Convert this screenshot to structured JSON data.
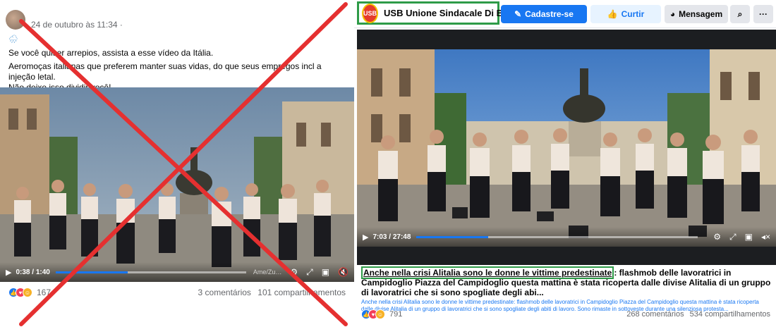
{
  "left_post": {
    "timestamp": "24 de outubro às 11:34 ·",
    "emoji": "🌧",
    "text_lines": [
      "Se você quiser arrepios, assista a esse vídeo da Itália.",
      " Aeromoças italianas que preferem manter suas vidas, do que seus empregos incl a injeção letal.",
      "Não deixe isso dividir você!"
    ],
    "video": {
      "time": "0:38 / 1:40",
      "progress": 0.38,
      "watermark": "Ame/Zu…"
    },
    "reaction_count": "167",
    "comments": "3 comentários",
    "shares": "101 compartilhamentos"
  },
  "right_post": {
    "page_name": "USB Unione Sindacale Di B...",
    "logo_text": "USB",
    "buttons": {
      "signup": "Cadastre-se",
      "like": "Curtir",
      "message": "Mensagem"
    },
    "video": {
      "time": "7:03 / 27:48",
      "progress": 0.254
    },
    "caption_highlight": "Anche nella crisi Alitalia sono le donne le vittime predestinate",
    "caption_rest": ": flashmob delle lavoratrici in Campidoglio Piazza del Campidoglio questa mattina è stata ricoperta dalle divise Alitalia di un gruppo di lavoratrici che si sono spogliate degli abi...",
    "caption_desc": "Anche nella crisi Alitalia sono le donne le vittime predestinate: flashmob delle lavoratrici in Campidoglio Piazza del Campidoglio questa mattina è stata ricoperta dalle divise Alitalia di un gruppo di lavoratrici che si sono spogliate degli abiti di lavoro. Sono rimaste in sottoveste durante una silenziosa protesta...",
    "reaction_count": "791",
    "comments": "268 comentários",
    "shares": "534 compartilhamentos"
  },
  "colors": {
    "facebook_blue": "#1877f2",
    "highlight_green": "#2e9b48",
    "cross_red": "#e53030"
  }
}
